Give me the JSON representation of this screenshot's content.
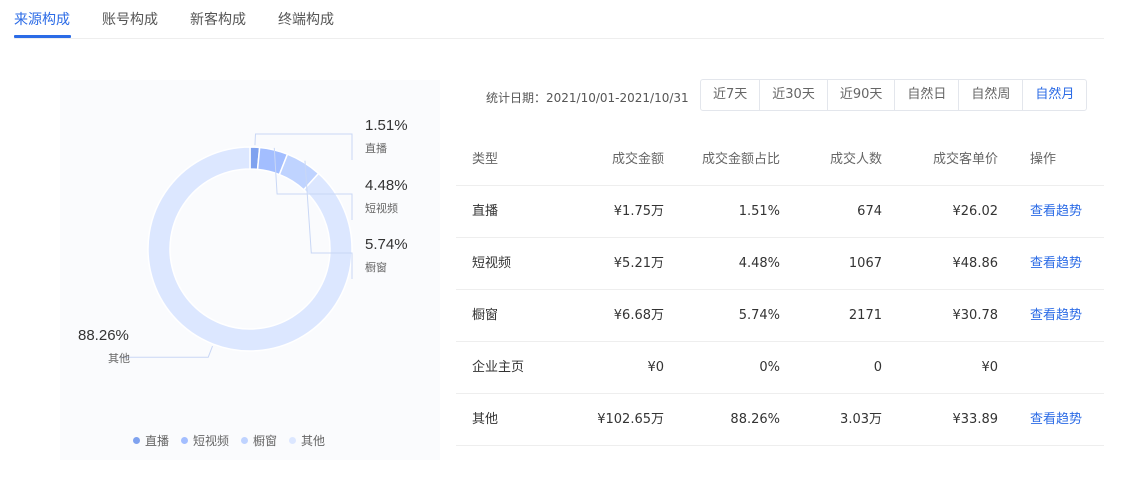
{
  "tabs": [
    {
      "label": "来源构成",
      "active": true
    },
    {
      "label": "账号构成",
      "active": false
    },
    {
      "label": "新客构成",
      "active": false
    },
    {
      "label": "终端构成",
      "active": false
    }
  ],
  "filter": {
    "date_label": "统计日期：2021/10/01-2021/10/31",
    "periods": [
      {
        "label": "近7天",
        "active": false
      },
      {
        "label": "近30天",
        "active": false
      },
      {
        "label": "近90天",
        "active": false
      },
      {
        "label": "自然日",
        "active": false
      },
      {
        "label": "自然周",
        "active": false
      },
      {
        "label": "自然月",
        "active": true
      }
    ]
  },
  "chart_data": {
    "type": "pie",
    "donut": true,
    "slices": [
      {
        "name": "直播",
        "value": 1.51,
        "label": "1.51%",
        "color": "#7fa2ef"
      },
      {
        "name": "短视频",
        "value": 4.48,
        "label": "4.48%",
        "color": "#a3beff"
      },
      {
        "name": "橱窗",
        "value": 5.74,
        "label": "5.74%",
        "color": "#bfd3ff"
      },
      {
        "name": "其他",
        "value": 88.26,
        "label": "88.26%",
        "color": "#dce7ff"
      }
    ],
    "legend_position": "bottom"
  },
  "table": {
    "columns": [
      "类型",
      "成交金额",
      "成交金额占比",
      "成交人数",
      "成交客单价",
      "操作"
    ],
    "rows": [
      {
        "type": "直播",
        "amount": "¥1.75万",
        "ratio": "1.51%",
        "people": "674",
        "unit_price": "¥26.02",
        "action": "查看趋势"
      },
      {
        "type": "短视频",
        "amount": "¥5.21万",
        "ratio": "4.48%",
        "people": "1067",
        "unit_price": "¥48.86",
        "action": "查看趋势"
      },
      {
        "type": "橱窗",
        "amount": "¥6.68万",
        "ratio": "5.74%",
        "people": "2171",
        "unit_price": "¥30.78",
        "action": "查看趋势"
      },
      {
        "type": "企业主页",
        "amount": "¥0",
        "ratio": "0%",
        "people": "0",
        "unit_price": "¥0",
        "action": ""
      },
      {
        "type": "其他",
        "amount": "¥102.65万",
        "ratio": "88.26%",
        "people": "3.03万",
        "unit_price": "¥33.89",
        "action": "查看趋势"
      }
    ]
  },
  "colors": {
    "accent": "#2b6be6"
  }
}
